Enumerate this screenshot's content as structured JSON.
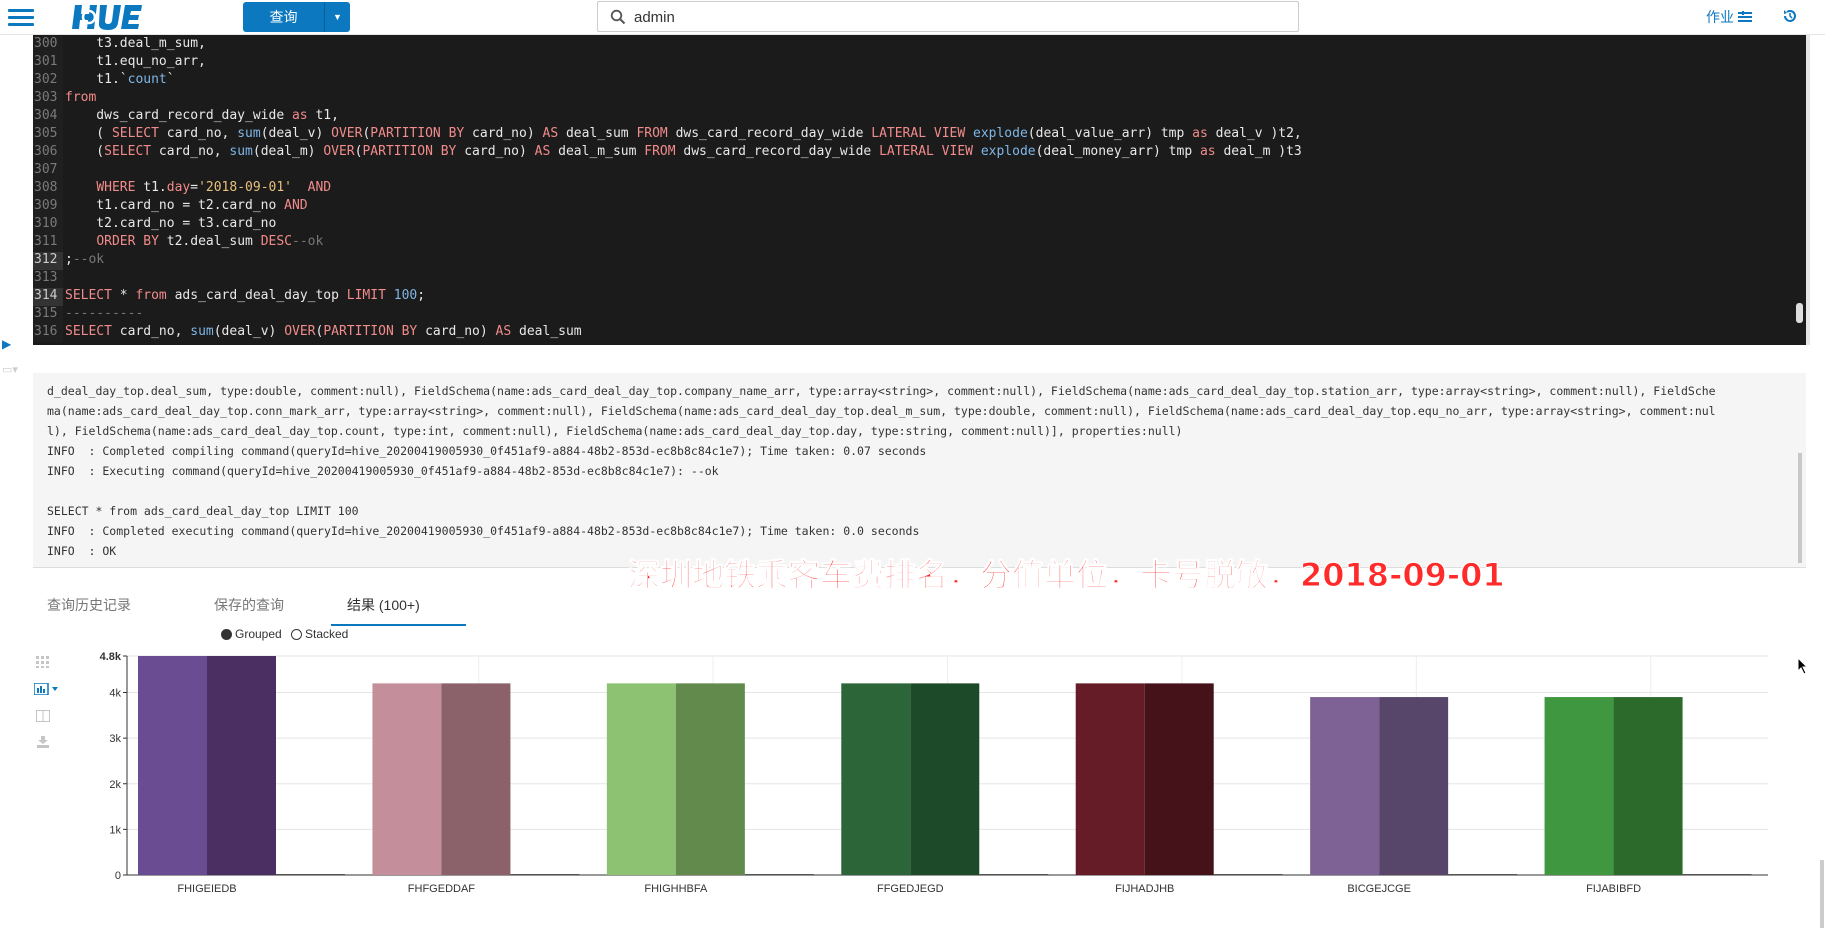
{
  "app": {
    "logo_text": "HUE",
    "query_button": "查询",
    "search_value": "admin",
    "jobs_label": "作业"
  },
  "editor": {
    "lines": [
      {
        "n": "300",
        "html": "    t3.deal_m_sum,"
      },
      {
        "n": "301",
        "html": "    t1.equ_no_arr,"
      },
      {
        "n": "302",
        "html": "    t1.`<span class=\"fn\">count</span>`"
      },
      {
        "n": "303",
        "html": "<span class=\"kw\">from</span>"
      },
      {
        "n": "304",
        "html": "    dws_card_record_day_wide <span class=\"kw\">as</span> t1,"
      },
      {
        "n": "305",
        "html": "    ( <span class=\"kw\">SELECT</span> card_no, <span class=\"fn\">sum</span>(deal_v) <span class=\"kw\">OVER</span>(<span class=\"kw\">PARTITION BY</span> card_no) <span class=\"kw\">AS</span> deal_sum <span class=\"kw\">FROM</span> dws_card_record_day_wide <span class=\"kw\">LATERAL VIEW</span> <span class=\"fn\">explode</span>(deal_value_arr) tmp <span class=\"kw\">as</span> deal_v )t2,"
      },
      {
        "n": "306",
        "html": "    (<span class=\"kw\">SELECT</span> card_no, <span class=\"fn\">sum</span>(deal_m) <span class=\"kw\">OVER</span>(<span class=\"kw\">PARTITION BY</span> card_no) <span class=\"kw\">AS</span> deal_m_sum <span class=\"kw\">FROM</span> dws_card_record_day_wide <span class=\"kw\">LATERAL VIEW</span> <span class=\"fn\">explode</span>(deal_money_arr) tmp <span class=\"kw\">as</span> deal_m )t3"
      },
      {
        "n": "307",
        "html": ""
      },
      {
        "n": "308",
        "html": "    <span class=\"kw\">WHERE</span> t1.<span class=\"kw\">day</span>=<span class=\"str\">'2018-09-01'</span>  <span class=\"kw\">AND</span>"
      },
      {
        "n": "309",
        "html": "    t1.card_no = t2.card_no <span class=\"kw\">AND</span>"
      },
      {
        "n": "310",
        "html": "    t2.card_no = t3.card_no"
      },
      {
        "n": "311",
        "html": "    <span class=\"kw\">ORDER BY</span> t2.deal_sum <span class=\"kw\">DESC</span><span class=\"cm\">--ok</span>"
      },
      {
        "n": "312",
        "html": ";<span class=\"cm\">--ok</span>",
        "active": true
      },
      {
        "n": "313",
        "html": ""
      },
      {
        "n": "314",
        "html": "<span class=\"kw\">SELECT</span> * <span class=\"kw\">from</span> ads_card_deal_day_top <span class=\"kw\">LIMIT</span> <span class=\"num\">100</span>;",
        "active": true
      },
      {
        "n": "315",
        "html": "<span class=\"cm\">----------</span>"
      },
      {
        "n": "316",
        "html": "<span class=\"kw\">SELECT</span> card_no, <span class=\"fn\">sum</span>(deal_v) <span class=\"kw\">OVER</span>(<span class=\"kw\">PARTITION BY</span> card_no) <span class=\"kw\">AS</span> deal_sum"
      }
    ]
  },
  "log": {
    "lines": [
      "d_deal_day_top.deal_sum, type:double, comment:null), FieldSchema(name:ads_card_deal_day_top.company_name_arr, type:array<string>, comment:null), FieldSchema(name:ads_card_deal_day_top.station_arr, type:array<string>, comment:null), FieldSche",
      "ma(name:ads_card_deal_day_top.conn_mark_arr, type:array<string>, comment:null), FieldSchema(name:ads_card_deal_day_top.deal_m_sum, type:double, comment:null), FieldSchema(name:ads_card_deal_day_top.equ_no_arr, type:array<string>, comment:nul",
      "l), FieldSchema(name:ads_card_deal_day_top.count, type:int, comment:null), FieldSchema(name:ads_card_deal_day_top.day, type:string, comment:null)], properties:null)",
      "INFO  : Completed compiling command(queryId=hive_20200419005930_0f451af9-a884-48b2-853d-ec8b8c84c1e7); Time taken: 0.07 seconds",
      "INFO  : Executing command(queryId=hive_20200419005930_0f451af9-a884-48b2-853d-ec8b8c84c1e7): --ok",
      "",
      "SELECT * from ads_card_deal_day_top LIMIT 100",
      "INFO  : Completed executing command(queryId=hive_20200419005930_0f451af9-a884-48b2-853d-ec8b8c84c1e7); Time taken: 0.0 seconds",
      "INFO  : OK"
    ]
  },
  "overlay": {
    "caption": "深圳地铁乘客车费排名，分值单位，卡号脱敏，2018-09-01"
  },
  "tabs": [
    {
      "label": "查询历史记录",
      "active": false
    },
    {
      "label": "保存的查询",
      "active": false
    },
    {
      "label": "结果 (100+)",
      "active": true
    }
  ],
  "legend": {
    "grouped": "Grouped",
    "stacked": "Stacked",
    "mode": "grouped"
  },
  "chart_data": {
    "type": "bar",
    "categories": [
      "FHIGEIEDB",
      "FHFGEDDAF",
      "FHIGHHBFA",
      "FFGEDJEGD",
      "FIJHADJHB",
      "BICGEJCGE",
      "FIJABIBFD"
    ],
    "series": [
      {
        "values": [
          4800,
          4200,
          4200,
          4200,
          4200,
          3900,
          3900
        ]
      },
      {
        "values": [
          4800,
          4200,
          4200,
          4200,
          4200,
          3900,
          3900
        ]
      },
      {
        "values": [
          10,
          10,
          10,
          10,
          10,
          10,
          10
        ]
      }
    ],
    "colors": [
      [
        "#6a4c93",
        "#4b2f63"
      ],
      [
        "#c48f9a",
        "#8b6269"
      ],
      [
        "#8cc272",
        "#628a4d"
      ],
      [
        "#2c6537",
        "#1d4a28"
      ],
      [
        "#661c26",
        "#451219"
      ],
      [
        "#7e6295",
        "#57456a"
      ],
      [
        "#3f973f",
        "#2c6a2c"
      ]
    ],
    "ylim": [
      0,
      4800
    ],
    "yticks": [
      0,
      1000,
      2000,
      3000,
      4000,
      4800
    ],
    "ytick_labels": [
      "0",
      "1k",
      "2k",
      "3k",
      "4k",
      "4.8k"
    ],
    "grid": true
  }
}
